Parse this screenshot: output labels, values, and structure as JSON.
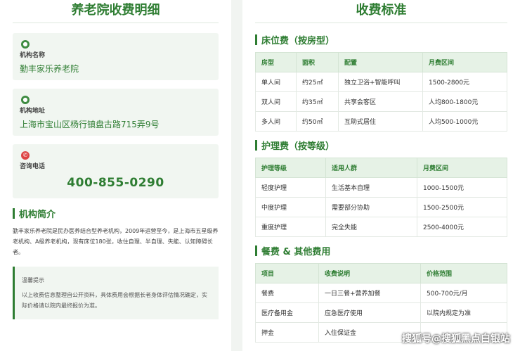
{
  "left": {
    "title": "养老院收费明细",
    "cards": [
      {
        "icon": "location-pin-icon",
        "label": "机构名称",
        "value": "勤丰家乐养老院"
      },
      {
        "icon": "location-pin-icon",
        "label": "机构地址",
        "value": "上海市宝山区杨行镇盘古路715弄9号"
      },
      {
        "icon": "phone-icon",
        "label": "咨询电话",
        "value": "400-855-0290"
      }
    ],
    "intro_title": "机构简介",
    "intro_text": "勤丰家乐养老院是民办医养结合型养老机构，2009年运营至今，是上海市五星级养老机构、A级养老机构，现有床位180张，收住自理、半自理、失能、认知障碍长者。",
    "tip_title": "温馨提示",
    "tip_text": "以上收费信息整理自公开资料，具体费用会根据长者身体评估情况确定，实际价格请以院内最终报价为准。"
  },
  "right": {
    "title": "收费标准",
    "sections": [
      {
        "title": "床位费（按房型）",
        "headers": [
          "房型",
          "面积",
          "配置",
          "月费区间"
        ],
        "rows": [
          [
            "单人间",
            "约25㎡",
            "独立卫浴+智能呼叫",
            "1500-2800元"
          ],
          [
            "双人间",
            "约35㎡",
            "共享会客区",
            "人均800-1800元"
          ],
          [
            "多人间",
            "约50㎡",
            "互助式居住",
            "人均500-1000元"
          ]
        ]
      },
      {
        "title": "护理费（按等级）",
        "headers": [
          "护理等级",
          "适用人群",
          "月费区间"
        ],
        "rows": [
          [
            "轻度护理",
            "生活基本自理",
            "1000-1500元"
          ],
          [
            "中度护理",
            "需要部分协助",
            "1500-2500元"
          ],
          [
            "重度护理",
            "完全失能",
            "2500-4000元"
          ]
        ]
      },
      {
        "title": "餐费 & 其他费用",
        "headers": [
          "项目",
          "收费说明",
          "价格范围"
        ],
        "rows": [
          [
            "餐费",
            "一日三餐+营养加餐",
            "500-700元/月"
          ],
          [
            "医疗备用金",
            "应急医疗使用",
            "以院内规定为准"
          ],
          [
            "押金",
            "入住保证金",
            ""
          ]
        ]
      }
    ]
  },
  "watermark": "搜狐号@搜狐黑点白银站",
  "colors": {
    "accent": "#2e7d32",
    "card_bg": "#f1f6f1",
    "header_bg": "#e6f2e6"
  }
}
